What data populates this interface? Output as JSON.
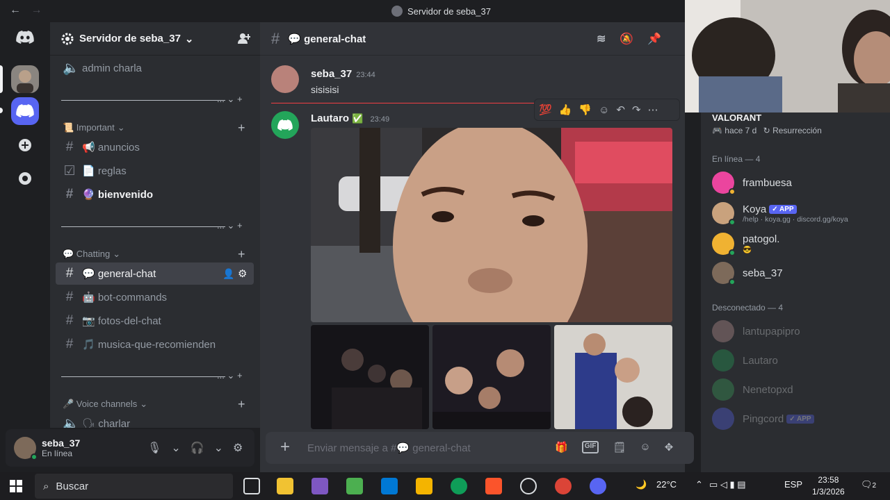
{
  "window": {
    "title": "Servidor de seba_37",
    "back": "←",
    "forward": "→"
  },
  "guild": {
    "name": "Servidor de seba_37",
    "chevron": "⌄"
  },
  "sidebar": {
    "top_channel": "admin charla",
    "categories": [
      {
        "label": "📜 Important",
        "chevron": "⌄"
      },
      {
        "label": "💬 Chatting",
        "chevron": "⌄"
      },
      {
        "label": "🎤 Voice channels",
        "chevron": "⌄"
      }
    ],
    "channels": [
      {
        "label": "📢 anuncios"
      },
      {
        "label": "📄 reglas"
      },
      {
        "label": "🔮 bienvenido"
      },
      {
        "label": "💬 general-chat"
      },
      {
        "label": "🤖 bot-commands"
      },
      {
        "label": "📷 fotos-del-chat"
      },
      {
        "label": "🎵 musica-que-recomienden"
      },
      {
        "label": "🗣 charlar"
      }
    ],
    "divider_controls": "... ⌄ +"
  },
  "user_panel": {
    "username": "seba_37",
    "status": "En línea"
  },
  "chat": {
    "channel": "💬 general-chat",
    "messages": [
      {
        "author": "seba_37",
        "time": "23:44",
        "text": "sisisisi"
      },
      {
        "author": "Lautaro",
        "time": "23:49",
        "badge": "✅"
      }
    ],
    "reactions": [
      "💯",
      "👍",
      "👎",
      "☺",
      "↶",
      "↷",
      "⋯"
    ],
    "input_placeholder": "Enviar mensaje a #💬 general-chat"
  },
  "members": {
    "activity": {
      "game": "VALORANT",
      "ago": "hace 7 d",
      "mode": "Resurrección"
    },
    "online_header": "En línea — 4",
    "offline_header": "Desconectado — 4",
    "online": [
      {
        "name": "frambuesa",
        "color": "#eb459e"
      },
      {
        "name": "Koya",
        "badge": "✓ APP",
        "sub": "/help · koya.gg · discord.gg/koya",
        "color": "#c9a27d"
      },
      {
        "name": "patogol.",
        "sub": "😎",
        "color": "#f0b232"
      },
      {
        "name": "seba_37",
        "color": "#7d6a5a"
      }
    ],
    "offline": [
      {
        "name": "lantupapipro",
        "color": "#c99d9d"
      },
      {
        "name": "Lautaro",
        "color": "#23a55a"
      },
      {
        "name": "Nenetopxd",
        "color": "#3ba55c"
      },
      {
        "name": "Pingcord",
        "badge": "✓ APP",
        "color": "#5865f2"
      }
    ]
  },
  "taskbar": {
    "search": "Buscar",
    "temperature": "22°C",
    "lang": "ESP",
    "time": "23:58",
    "date": "1/3/2026",
    "notifications": "2"
  },
  "colors": {
    "accent": "#5865f2",
    "online": "#23a55a",
    "new_marker": "#f23f43",
    "background": "#313338"
  }
}
